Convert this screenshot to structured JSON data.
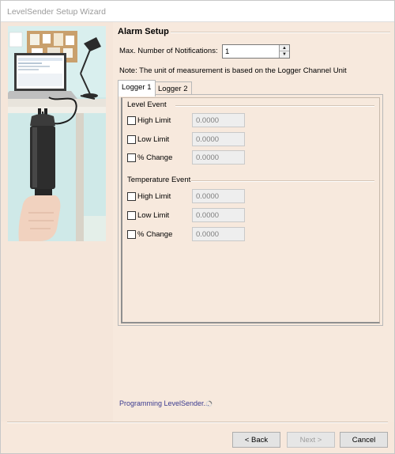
{
  "window": {
    "title": "LevelSender Setup Wizard"
  },
  "header": {
    "title": "Alarm Setup"
  },
  "notifications": {
    "label": "Max. Number of Notifications:",
    "value": "1"
  },
  "note": "Note: The unit of measurement is based on the Logger Channel Unit",
  "tabs": [
    {
      "label": "Logger 1",
      "active": true
    },
    {
      "label": "Logger 2",
      "active": false
    }
  ],
  "level_event": {
    "title": "Level Event",
    "rows": [
      {
        "label": "High Limit",
        "value": "0.0000",
        "checked": false
      },
      {
        "label": "Low Limit",
        "value": "0.0000",
        "checked": false
      },
      {
        "label": "% Change",
        "value": "0.0000",
        "checked": false
      }
    ]
  },
  "temperature_event": {
    "title": "Temperature Event",
    "rows": [
      {
        "label": "High Limit",
        "value": "0.0000",
        "checked": false
      },
      {
        "label": "Low Limit",
        "value": "0.0000",
        "checked": false
      },
      {
        "label": "% Change",
        "value": "0.0000",
        "checked": false
      }
    ]
  },
  "status": {
    "text": "Programming LevelSender..."
  },
  "buttons": {
    "back": "< Back",
    "next": "Next >",
    "cancel": "Cancel"
  },
  "icons": {
    "spin_up": "spin-up-icon",
    "spin_down": "spin-down-icon",
    "progress": "progress-spinner-icon",
    "illustration": "levelsender-illustration"
  },
  "colors": {
    "background": "#f7e9dd",
    "status_text": "#3b3b8f",
    "disabled_text": "#9d9d9d"
  }
}
